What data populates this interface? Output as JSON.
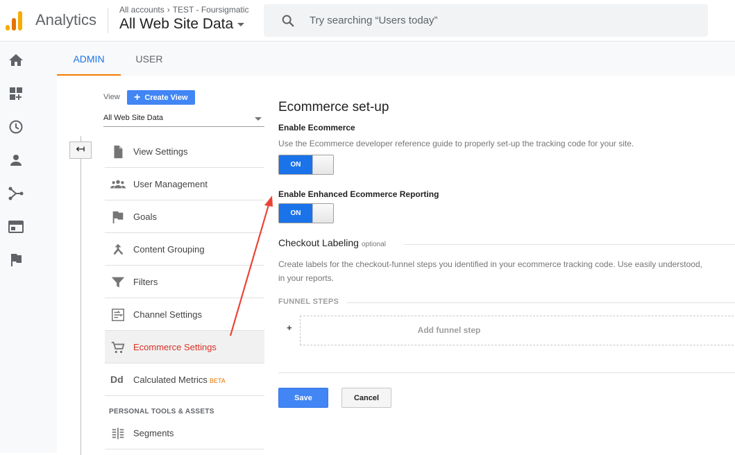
{
  "header": {
    "app_name": "Analytics",
    "breadcrumb": [
      "All accounts",
      "TEST - Foursigmatic"
    ],
    "property": "All Web Site Data",
    "search_placeholder": "Try searching “Users today”"
  },
  "colors": {
    "accent_blue": "#1a73e8",
    "tab_underline": "#f57c00",
    "active_item": "#d93025",
    "arrow": "#ea4335"
  },
  "tabs": [
    {
      "label": "ADMIN",
      "active": true
    },
    {
      "label": "USER",
      "active": false
    }
  ],
  "leftnav": [
    "home-icon",
    "dashboard-icon",
    "clock-icon",
    "person-icon",
    "acquisition-icon",
    "behavior-icon",
    "flag-icon"
  ],
  "view_panel": {
    "label": "View",
    "create_button": "Create View",
    "selected_view": "All Web Site Data"
  },
  "menu": {
    "items": [
      {
        "label": "View Settings",
        "icon": "document-icon"
      },
      {
        "label": "User Management",
        "icon": "people-icon"
      },
      {
        "label": "Goals",
        "icon": "flag-icon"
      },
      {
        "label": "Content Grouping",
        "icon": "merge-icon"
      },
      {
        "label": "Filters",
        "icon": "filter-icon"
      },
      {
        "label": "Channel Settings",
        "icon": "channel-icon"
      },
      {
        "label": "Ecommerce Settings",
        "icon": "cart-icon",
        "active": true
      },
      {
        "label": "Calculated Metrics",
        "icon": "dd-icon",
        "badge": "BETA"
      }
    ],
    "section_title": "PERSONAL TOOLS & ASSETS",
    "section_items": [
      {
        "label": "Segments",
        "icon": "segments-icon"
      }
    ]
  },
  "main": {
    "title": "Ecommerce set-up",
    "enable_ecommerce": {
      "label": "Enable Ecommerce",
      "description": "Use the Ecommerce developer reference guide to properly set-up the tracking code for your site.",
      "toggle": "ON"
    },
    "enhanced": {
      "label": "Enable Enhanced Ecommerce Reporting",
      "toggle": "ON"
    },
    "checkout": {
      "title": "Checkout Labeling",
      "optional": "optional",
      "description_line1": "Create labels for the checkout-funnel steps you identified in your ecommerce tracking code. Use easily understood,",
      "description_line2": "in your reports.",
      "funnel_heading": "FUNNEL STEPS",
      "plus": "+",
      "add_step": "Add funnel step"
    },
    "save": "Save",
    "cancel": "Cancel"
  }
}
